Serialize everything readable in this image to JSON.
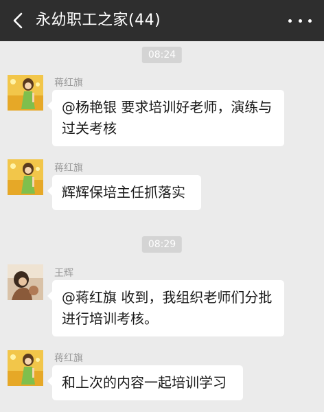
{
  "header": {
    "title": "永幼职工之家(44)",
    "back_icon": "chevron-left-icon",
    "more_icon": "more-dots-icon",
    "bg_color": "#2e2e2e"
  },
  "timestamps": [
    "08:24",
    "08:29"
  ],
  "messages": [
    {
      "sender": "蒋红旗",
      "avatar": "girl-illustration-avatar",
      "text": "@杨艳银  要求培训好老师，演练与过关考核"
    },
    {
      "sender": "蒋红旗",
      "avatar": "girl-illustration-avatar",
      "text": "辉辉保培主任抓落实"
    },
    {
      "sender": "王辉",
      "avatar": "photo-avatar",
      "text": "@蒋红旗  收到，我组织老师们分批进行培训考核。"
    },
    {
      "sender": "蒋红旗",
      "avatar": "girl-illustration-avatar",
      "text": "和上次的内容一起培训学习"
    }
  ],
  "colors": {
    "background": "#ebebeb",
    "bubble": "#ffffff",
    "timestamp_bg": "#d4d4d4",
    "sender_name": "#9a9a9a"
  }
}
